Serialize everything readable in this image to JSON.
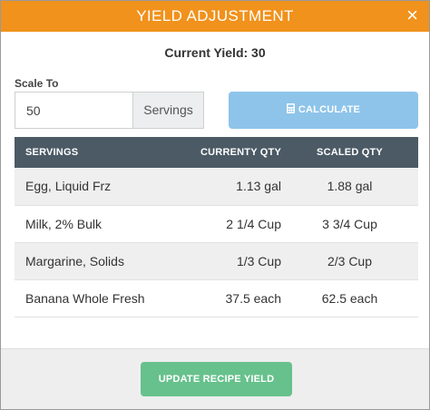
{
  "header": {
    "title": "YIELD ADJUSTMENT",
    "close_glyph": "×"
  },
  "current_yield": "Current Yield: 30",
  "scale": {
    "label": "Scale To",
    "value": "50",
    "unit": "Servings"
  },
  "calculate_button": {
    "label": "CALCULATE",
    "icon": "calculator-icon"
  },
  "table": {
    "headers": [
      "SERVINGS",
      "CURRENTY QTY",
      "SCALED QTY"
    ],
    "rows": [
      [
        "Egg, Liquid Frz",
        "1.13 gal",
        "1.88 gal"
      ],
      [
        "Milk, 2% Bulk",
        "2 1/4 Cup",
        "3 3/4 Cup"
      ],
      [
        "Margarine, Solids",
        "1/3 Cup",
        "2/3 Cup"
      ],
      [
        "Banana Whole Fresh",
        "37.5 each",
        "62.5 each"
      ]
    ]
  },
  "footer": {
    "update_label": "UPDATE RECIPE YIELD"
  },
  "colors": {
    "header": "#f0921c",
    "calculate": "#8ec4ea",
    "table_header": "#4b5a65",
    "update": "#67c18c"
  }
}
